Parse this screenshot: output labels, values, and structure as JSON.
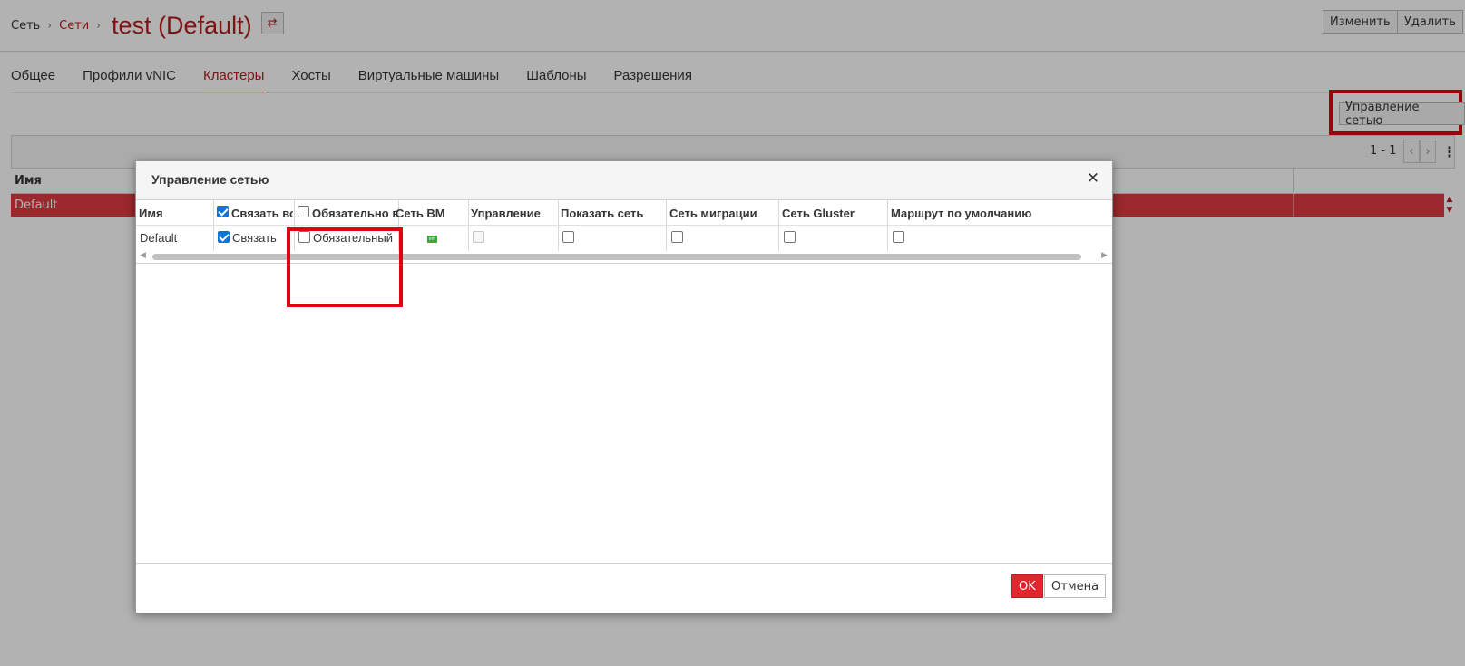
{
  "breadcrumb": {
    "root": "Сеть",
    "parent": "Сети",
    "title": "test (Default)"
  },
  "header_actions": {
    "edit": "Изменить",
    "remove": "Удалить"
  },
  "tabs": [
    "Общее",
    "Профили vNIC",
    "Кластеры",
    "Хосты",
    "Виртуальные машины",
    "Шаблоны",
    "Разрешения"
  ],
  "active_tab": "Кластеры",
  "toolbar": {
    "manage_network": "Управление сетью",
    "pager": "1 - 1"
  },
  "grid": {
    "header_name": "Имя",
    "rows": [
      {
        "name": "Default",
        "selected": true
      }
    ]
  },
  "dialog": {
    "title": "Управление сетью",
    "columns": {
      "name": "Имя",
      "attach_all": "Связать всё",
      "required_all": "Обязательно все",
      "vm_network": "Сеть ВМ",
      "management": "Управление",
      "display": "Показать сеть",
      "migration": "Сеть миграции",
      "gluster": "Сеть Gluster",
      "default_route": "Маршрут по умолчанию"
    },
    "header_checks": {
      "attach_all": true,
      "required_all": false
    },
    "row": {
      "name": "Default",
      "attach_label": "Связать",
      "attach": true,
      "required_label": "Обязательный",
      "required": false,
      "vm_icon": "vm",
      "management": false,
      "display": false,
      "migration": false,
      "gluster": false,
      "default_route": false
    },
    "ok": "OK",
    "cancel": "Отмена"
  },
  "colors": {
    "accent": "#b71c1c",
    "selected_row": "#dd3a3f",
    "highlight": "#e3000f",
    "ok_button": "#e3262e",
    "checkbox_checked": "#0a74d8"
  }
}
